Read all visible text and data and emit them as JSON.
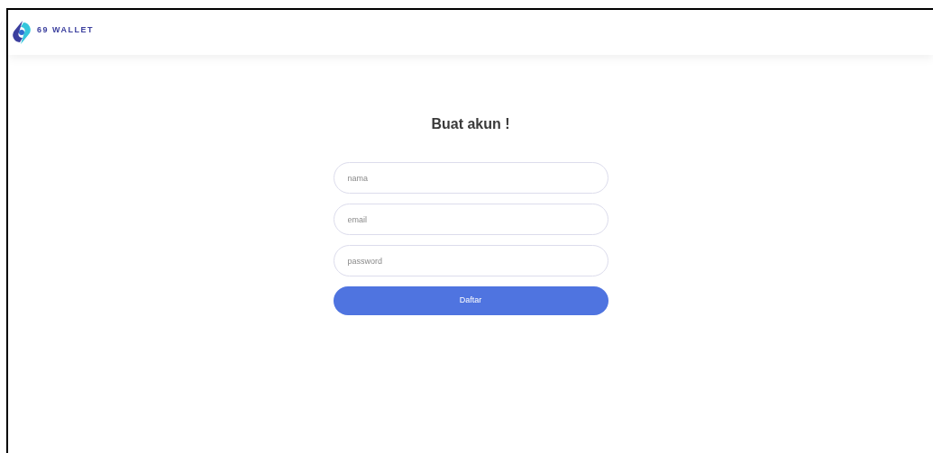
{
  "header": {
    "logo_text": "69 WALLET"
  },
  "form": {
    "title": "Buat akun !",
    "fields": [
      {
        "placeholder": "nama"
      },
      {
        "placeholder": "email"
      },
      {
        "placeholder": "password"
      }
    ],
    "submit": "Daftar"
  }
}
